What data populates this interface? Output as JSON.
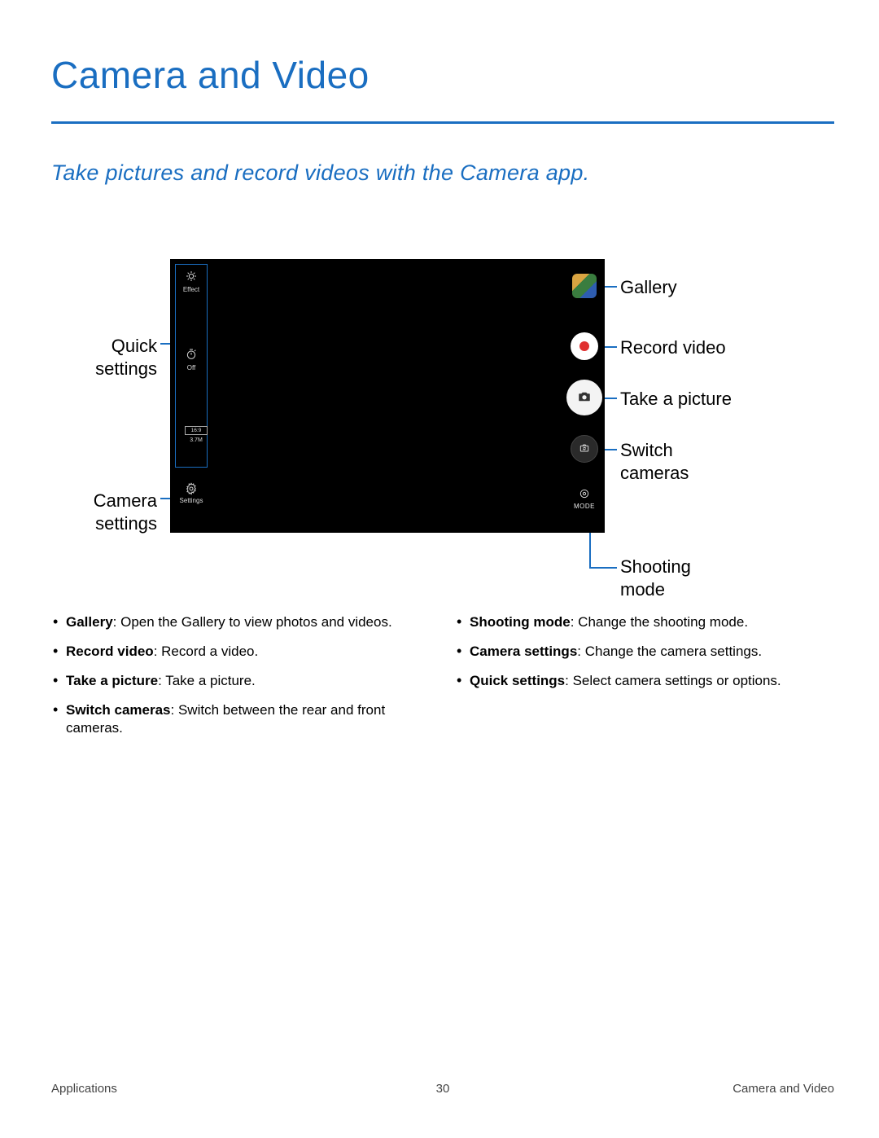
{
  "title": "Camera and Video",
  "subtitle": "Take pictures and record videos with the Camera app.",
  "callouts": {
    "quick_settings": "Quick\nsettings",
    "camera_settings": "Camera\nsettings",
    "gallery": "Gallery",
    "record_video": "Record video",
    "take_picture": "Take a picture",
    "switch_cameras": "Switch\ncameras",
    "shooting_mode": "Shooting\nmode"
  },
  "camera_ui": {
    "effect_label": "Effect",
    "timer_label": "Off",
    "ratio": "16:9",
    "resolution": "3.7M",
    "settings_label": "Settings",
    "mode_label": "MODE"
  },
  "bullets_left": [
    {
      "term": "Gallery",
      "desc": ": Open the Gallery to view photos and videos."
    },
    {
      "term": "Record video",
      "desc": ": Record a video."
    },
    {
      "term": "Take a picture",
      "desc": ": Take a picture."
    },
    {
      "term": "Switch cameras",
      "desc": ": Switch between the rear and front cameras."
    }
  ],
  "bullets_right": [
    {
      "term": "Shooting mode",
      "desc": ": Change the shooting mode."
    },
    {
      "term": "Camera settings",
      "desc": ": Change the camera settings."
    },
    {
      "term": "Quick settings",
      "desc": ": Select camera settings or options."
    }
  ],
  "footer": {
    "left": "Applications",
    "center": "30",
    "right": "Camera and Video"
  }
}
